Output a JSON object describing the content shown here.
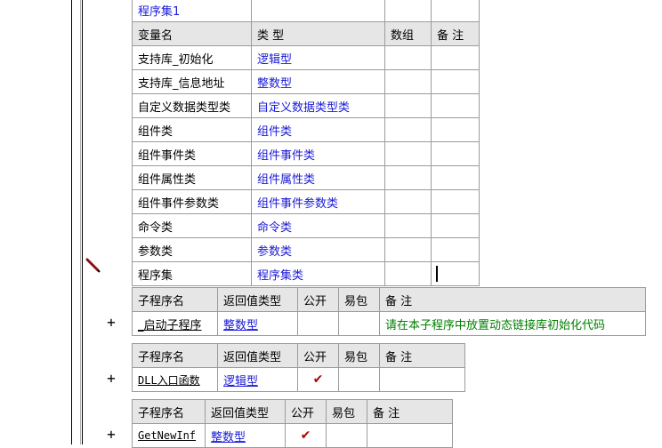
{
  "variables_table": {
    "set_name": "程序集1",
    "headers": [
      "变量名",
      "类 型",
      "数组",
      "备 注"
    ],
    "rows": [
      {
        "name": "支持库_初始化",
        "type": "逻辑型"
      },
      {
        "name": "支持库_信息地址",
        "type": "整数型"
      },
      {
        "name": "自定义数据类型类",
        "type": "自定义数据类型类"
      },
      {
        "name": "组件类",
        "type": "组件类"
      },
      {
        "name": "组件事件类",
        "type": "组件事件类"
      },
      {
        "name": "组件属性类",
        "type": "组件属性类"
      },
      {
        "name": "组件事件参数类",
        "type": "组件事件参数类"
      },
      {
        "name": "命令类",
        "type": "命令类"
      },
      {
        "name": "参数类",
        "type": "参数类"
      },
      {
        "name": "程序集",
        "type": "程序集类"
      }
    ]
  },
  "subroutines": [
    {
      "expander": "+",
      "headers": [
        "子程序名",
        "返回值类型",
        "公开",
        "易包",
        "备 注"
      ],
      "name": "_启动子程序",
      "return_type": "整数型",
      "public": "",
      "note": "请在本子程序中放置动态链接库初始化代码"
    },
    {
      "expander": "+",
      "headers": [
        "子程序名",
        "返回值类型",
        "公开",
        "易包",
        "备 注"
      ],
      "name": "DLL入口函数",
      "return_type": "逻辑型",
      "public": "✔",
      "note": ""
    },
    {
      "expander": "+",
      "headers": [
        "子程序名",
        "返回值类型",
        "公开",
        "易包",
        "备 注"
      ],
      "name": "GetNewInf",
      "return_type": "整数型",
      "public": "✔",
      "note": ""
    }
  ],
  "colors": {
    "type_text": "#1a1ad6",
    "note_text": "#008000",
    "header_bg": "#e6e6e6",
    "check": "#b00000"
  },
  "icons": {
    "edit_marker": "pencil-icon"
  }
}
